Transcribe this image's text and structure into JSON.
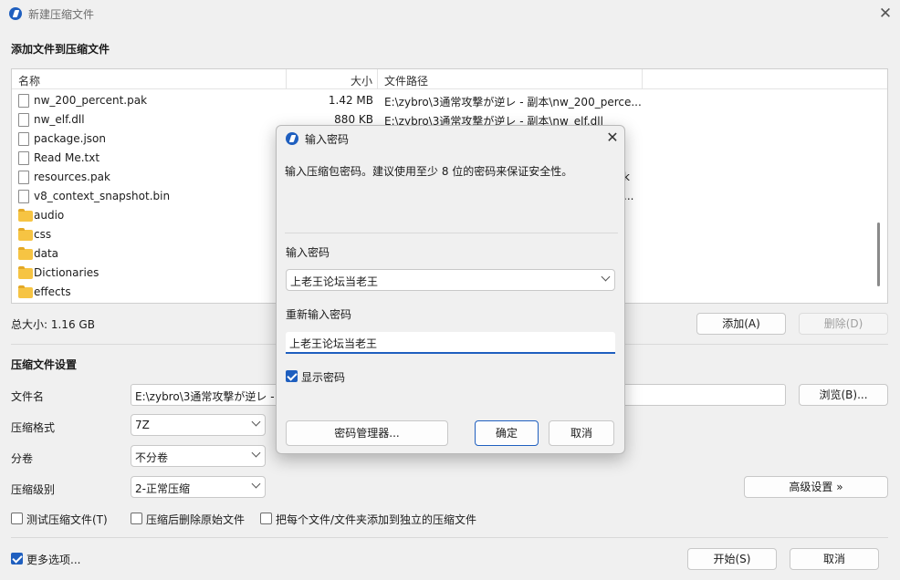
{
  "window": {
    "title": "新建压缩文件"
  },
  "add_section": {
    "title": "添加文件到压缩文件"
  },
  "file_list": {
    "columns": [
      "名称",
      "大小",
      "文件路径"
    ],
    "rows": [
      {
        "name": "nw_200_percent.pak",
        "size": "1.42 MB",
        "path": "E:\\zybro\\3通常攻撃が逆レ - 副本\\nw_200_perce...",
        "icon": "file-icon"
      },
      {
        "name": "nw_elf.dll",
        "size": "880 KB",
        "path": "E:\\zybro\\3通常攻撃が逆レ - 副本\\nw_elf.dll",
        "icon": "dll-file-icon"
      },
      {
        "name": "package.json",
        "size": "",
        "path": "",
        "icon": "json-file-icon"
      },
      {
        "name": "Read Me.txt",
        "size": "",
        "path": "",
        "icon": "text-file-icon"
      },
      {
        "name": "resources.pak",
        "size": "",
        "path": "k",
        "icon": "file-icon"
      },
      {
        "name": "v8_context_snapshot.bin",
        "size": "",
        "path": "...",
        "icon": "file-icon"
      },
      {
        "name": "audio",
        "size": "",
        "path": "",
        "icon": "folder-icon"
      },
      {
        "name": "css",
        "size": "",
        "path": "",
        "icon": "folder-icon"
      },
      {
        "name": "data",
        "size": "",
        "path": "",
        "icon": "folder-icon"
      },
      {
        "name": "Dictionaries",
        "size": "",
        "path": "",
        "icon": "folder-icon"
      },
      {
        "name": "effects",
        "size": "",
        "path": "",
        "icon": "folder-icon"
      }
    ]
  },
  "total_size": "总大小: 1.16 GB",
  "add_button": "添加(A)",
  "delete_button": "删除(D)",
  "settings": {
    "title": "压缩文件设置",
    "filename_label": "文件名",
    "filename_value": "E:\\zybro\\3通常攻撃が逆レ -",
    "browse_button": "浏览(B)...",
    "format_label": "压缩格式",
    "format_value": "7Z",
    "split_label": "分卷",
    "split_value": "不分卷",
    "level_label": "压缩级别",
    "level_value": "2-正常压缩",
    "advanced_button": "高级设置 »"
  },
  "options": {
    "test_archive": "测试压缩文件(T)",
    "delete_after": "压缩后删除原始文件",
    "separate_archives": "把每个文件/文件夹添加到独立的压缩文件",
    "more_options": "更多选项..."
  },
  "footer": {
    "start_button": "开始(S)",
    "cancel_button": "取消"
  },
  "dialog": {
    "title": "输入密码",
    "description": "输入压缩包密码。建议使用至少 8 位的密码来保证安全性。",
    "password_label": "输入密码",
    "password_value": "上老王论坛当老王",
    "confirm_label": "重新输入密码",
    "confirm_value": "上老王论坛当老王",
    "show_password": "显示密码",
    "manager_button": "密码管理器...",
    "ok_button": "确定",
    "cancel_button": "取消"
  },
  "colors": {
    "accent": "#1f5fbf",
    "background": "#f0f0f0"
  }
}
